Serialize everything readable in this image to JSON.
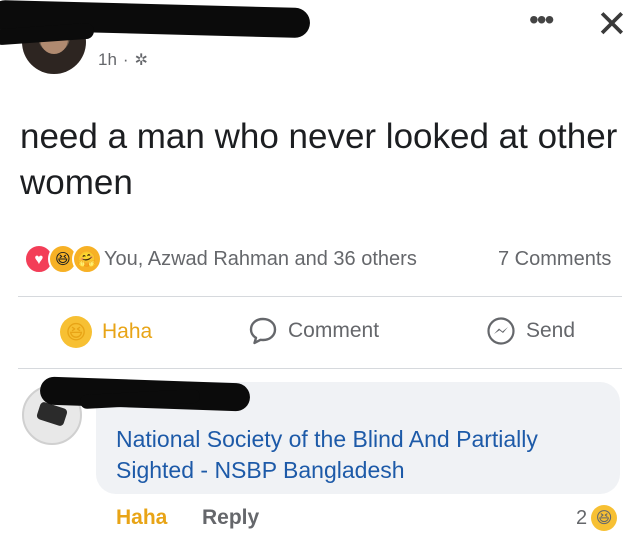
{
  "post": {
    "time": "1h",
    "separator": "·",
    "privacy_icon": "gear-icon",
    "more_label": "•••",
    "close_label": "✕",
    "text": "need a man who never looked at other women"
  },
  "reactions": {
    "icons": [
      "love-icon",
      "haha-icon",
      "care-icon"
    ],
    "names": "You, Azwad Rahman and 36 others",
    "comments_count": "7 Comments"
  },
  "actions": {
    "haha_label": "Haha",
    "comment_label": "Comment",
    "send_label": "Send"
  },
  "comment": {
    "text": "National Society of the Blind And Partially Sighted - NSBP Bangladesh",
    "haha_label": "Haha",
    "reply_label": "Reply",
    "reaction_count": "2"
  },
  "colors": {
    "haha_yellow": "#e8a416",
    "link_blue": "#1d5aa8",
    "bubble_bg": "#f0f2f5",
    "muted_text": "#65676b"
  }
}
